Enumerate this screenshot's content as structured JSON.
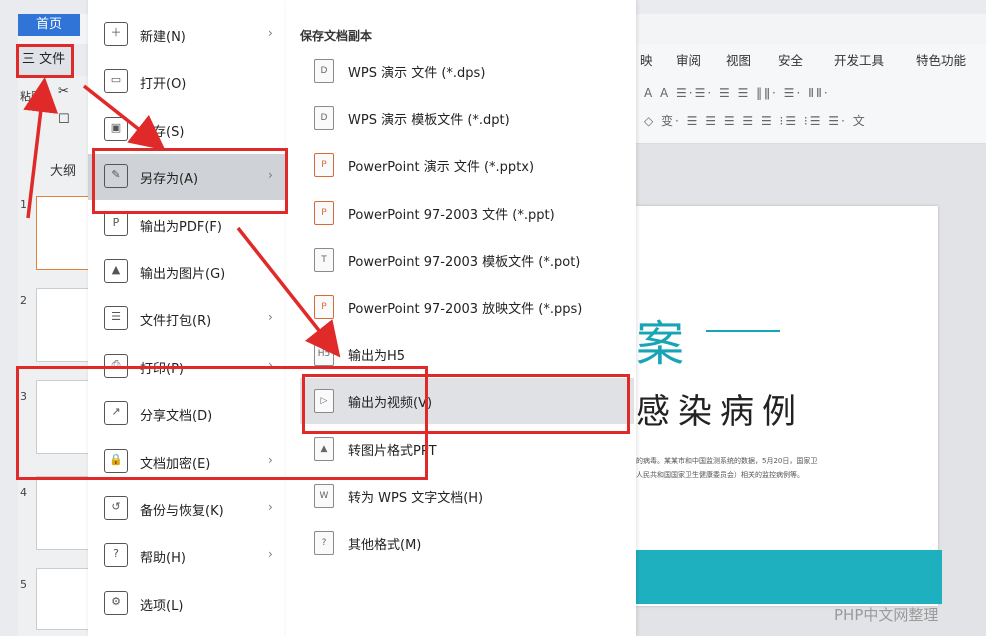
{
  "app": {
    "home_tab": "首页",
    "file_button": "三 文件",
    "ribbon_tabs": [
      "映",
      "审阅",
      "视图",
      "安全",
      "开发工具",
      "特色功能"
    ],
    "ribbon_row1": "A A  ☰·☰· ☰ ☰ ‖ǁ· ☰· ⅡⅡ·",
    "ribbon_row2": "◇ 变·  ☰ ☰ ☰ ☰ ☰ ⁝☰ ⁝☰ ☰·   文",
    "left_strip_labels": [
      "粘贴",
      "✂",
      "☐"
    ],
    "outline_label": "大纲",
    "slide_numbers": [
      "1",
      "2",
      "3",
      "4",
      "5"
    ]
  },
  "slide": {
    "title_char": "案",
    "subtitle": "感染病例",
    "small_text_1": "的病毒。某某市和中国监测系统的数据，5月20日，国家卫",
    "small_text_2": "人民共和国国家卫生健康委员会）相关的监控病例等。"
  },
  "file_menu": {
    "items": [
      {
        "label": "新建(N)",
        "icon": "new-file-icon",
        "glyph": "＋",
        "arrow": true
      },
      {
        "label": "打开(O)",
        "icon": "open-folder-icon",
        "glyph": "▭",
        "arrow": false
      },
      {
        "label": "保存(S)",
        "icon": "save-icon",
        "glyph": "▣",
        "arrow": false
      },
      {
        "label": "另存为(A)",
        "icon": "save-as-icon",
        "glyph": "✎",
        "arrow": true
      },
      {
        "label": "输出为PDF(F)",
        "icon": "export-pdf-icon",
        "glyph": "P",
        "arrow": false
      },
      {
        "label": "输出为图片(G)",
        "icon": "export-image-icon",
        "glyph": "▲",
        "arrow": false
      },
      {
        "label": "文件打包(R)",
        "icon": "package-icon",
        "glyph": "☰",
        "arrow": true
      },
      {
        "label": "打印(P)",
        "icon": "print-icon",
        "glyph": "⎙",
        "arrow": true
      },
      {
        "label": "分享文档(D)",
        "icon": "share-icon",
        "glyph": "↗",
        "arrow": false
      },
      {
        "label": "文档加密(E)",
        "icon": "encrypt-icon",
        "glyph": "🔒",
        "arrow": true
      },
      {
        "label": "备份与恢复(K)",
        "icon": "backup-icon",
        "glyph": "↺",
        "arrow": true
      },
      {
        "label": "帮助(H)",
        "icon": "help-icon",
        "glyph": "?",
        "arrow": true
      },
      {
        "label": "选项(L)",
        "icon": "settings-icon",
        "glyph": "⚙",
        "arrow": false
      }
    ]
  },
  "submenu": {
    "header": "保存文档副本",
    "items": [
      {
        "label": "WPS 演示 文件 (*.dps)",
        "icon": "dps-file-icon",
        "glyph": "D",
        "kind": "plain"
      },
      {
        "label": "WPS 演示 模板文件 (*.dpt)",
        "icon": "dpt-file-icon",
        "glyph": "D",
        "kind": "plain"
      },
      {
        "label": "PowerPoint 演示 文件 (*.pptx)",
        "icon": "pptx-file-icon",
        "glyph": "P",
        "kind": "ppt"
      },
      {
        "label": "PowerPoint 97-2003 文件 (*.ppt)",
        "icon": "ppt-file-icon",
        "glyph": "P",
        "kind": "ppt"
      },
      {
        "label": "PowerPoint 97-2003 模板文件 (*.pot)",
        "icon": "pot-file-icon",
        "glyph": "T",
        "kind": "plain"
      },
      {
        "label": "PowerPoint 97-2003 放映文件 (*.pps)",
        "icon": "pps-file-icon",
        "glyph": "P",
        "kind": "ppt"
      },
      {
        "label": "输出为H5",
        "icon": "h5-icon",
        "glyph": "H5",
        "kind": "plain"
      },
      {
        "label": "输出为视频(V)",
        "icon": "video-icon",
        "glyph": "▷",
        "kind": "plain"
      },
      {
        "label": "转图片格式PPT",
        "icon": "image-ppt-icon",
        "glyph": "▲",
        "kind": "plain"
      },
      {
        "label": "转为 WPS 文字文档(H)",
        "icon": "wps-doc-icon",
        "glyph": "W",
        "kind": "plain"
      },
      {
        "label": "其他格式(M)",
        "icon": "other-format-icon",
        "glyph": "?",
        "kind": "plain"
      }
    ]
  },
  "watermark": "PHP中文网整理",
  "colors": {
    "annotation_red": "#e02a2a",
    "accent_teal": "#17a4b4",
    "home_blue": "#2f74d6"
  }
}
